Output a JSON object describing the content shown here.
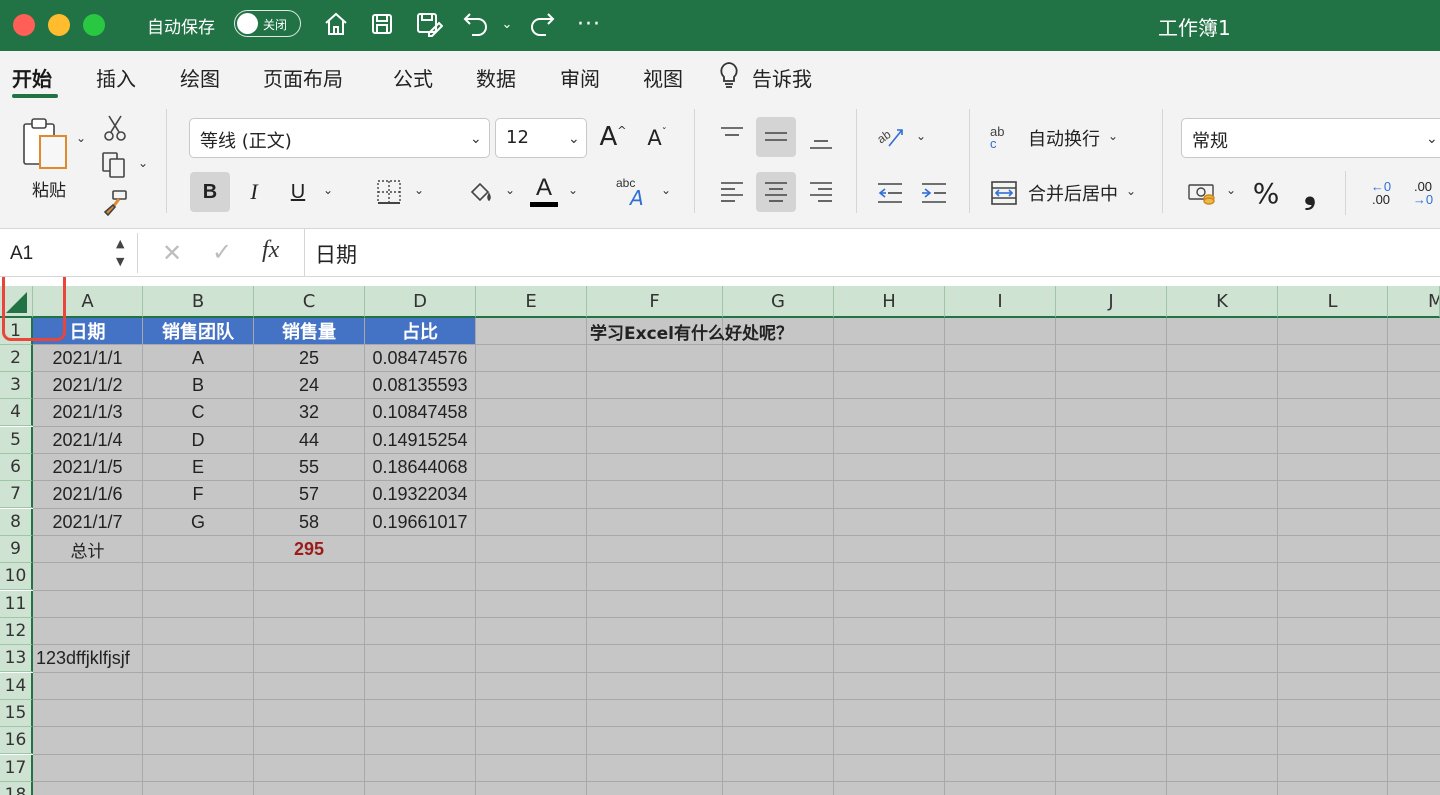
{
  "titlebar": {
    "autosave_label": "自动保存",
    "toggle_label": "关闭",
    "workbook_title": "工作簿1",
    "colors": {
      "bg": "#217346",
      "close": "#ff5f57",
      "min": "#febc2e",
      "max": "#28c840"
    }
  },
  "tabs": [
    {
      "label": "开始",
      "active": true
    },
    {
      "label": "插入"
    },
    {
      "label": "绘图"
    },
    {
      "label": "页面布局"
    },
    {
      "label": "公式"
    },
    {
      "label": "数据"
    },
    {
      "label": "审阅"
    },
    {
      "label": "视图"
    },
    {
      "label": "告诉我"
    }
  ],
  "ribbon": {
    "paste_label": "粘贴",
    "font_name": "等线 (正文)",
    "font_size": "12",
    "bold": "B",
    "italic": "I",
    "underline": "U",
    "font_color_glyph": "A",
    "grow_font": "A",
    "shrink_font": "A",
    "abc_label": "abc",
    "wrap_text_label": "自动换行",
    "merge_center_label": "合并后居中",
    "number_format": "常规",
    "percent": "%",
    "comma": "❟",
    "ab_label": "ab",
    "c_label": "c",
    "inc_decimal_top": "←0",
    "inc_decimal_bottom": ".00",
    "dec_decimal_top": ".00",
    "dec_decimal_bottom": "→0"
  },
  "formulabar": {
    "name_box": "A1",
    "fx": "fx",
    "content": "日期"
  },
  "columns": [
    "A",
    "B",
    "C",
    "D",
    "E",
    "F",
    "G",
    "H",
    "I",
    "J",
    "K",
    "L",
    "M"
  ],
  "rows": [
    "1",
    "2",
    "3",
    "4",
    "5",
    "6",
    "7",
    "8",
    "9",
    "10",
    "11",
    "12",
    "13",
    "14",
    "15",
    "16",
    "17",
    "18"
  ],
  "sheet": {
    "header": [
      "日期",
      "销售团队",
      "销售量",
      "占比"
    ],
    "data": [
      [
        "2021/1/1",
        "A",
        "25",
        "0.08474576"
      ],
      [
        "2021/1/2",
        "B",
        "24",
        "0.08135593"
      ],
      [
        "2021/1/3",
        "C",
        "32",
        "0.10847458"
      ],
      [
        "2021/1/4",
        "D",
        "44",
        "0.14915254"
      ],
      [
        "2021/1/5",
        "E",
        "55",
        "0.18644068"
      ],
      [
        "2021/1/6",
        "F",
        "57",
        "0.19322034"
      ],
      [
        "2021/1/7",
        "G",
        "58",
        "0.19661017"
      ]
    ],
    "total_label": "总计",
    "total_value": "295",
    "total_color": "#9c1c1c",
    "f1_text": "学习Excel有什么好处呢？",
    "a13_text": "123dffjklfjsjf",
    "header_fill": "#4472c4"
  }
}
